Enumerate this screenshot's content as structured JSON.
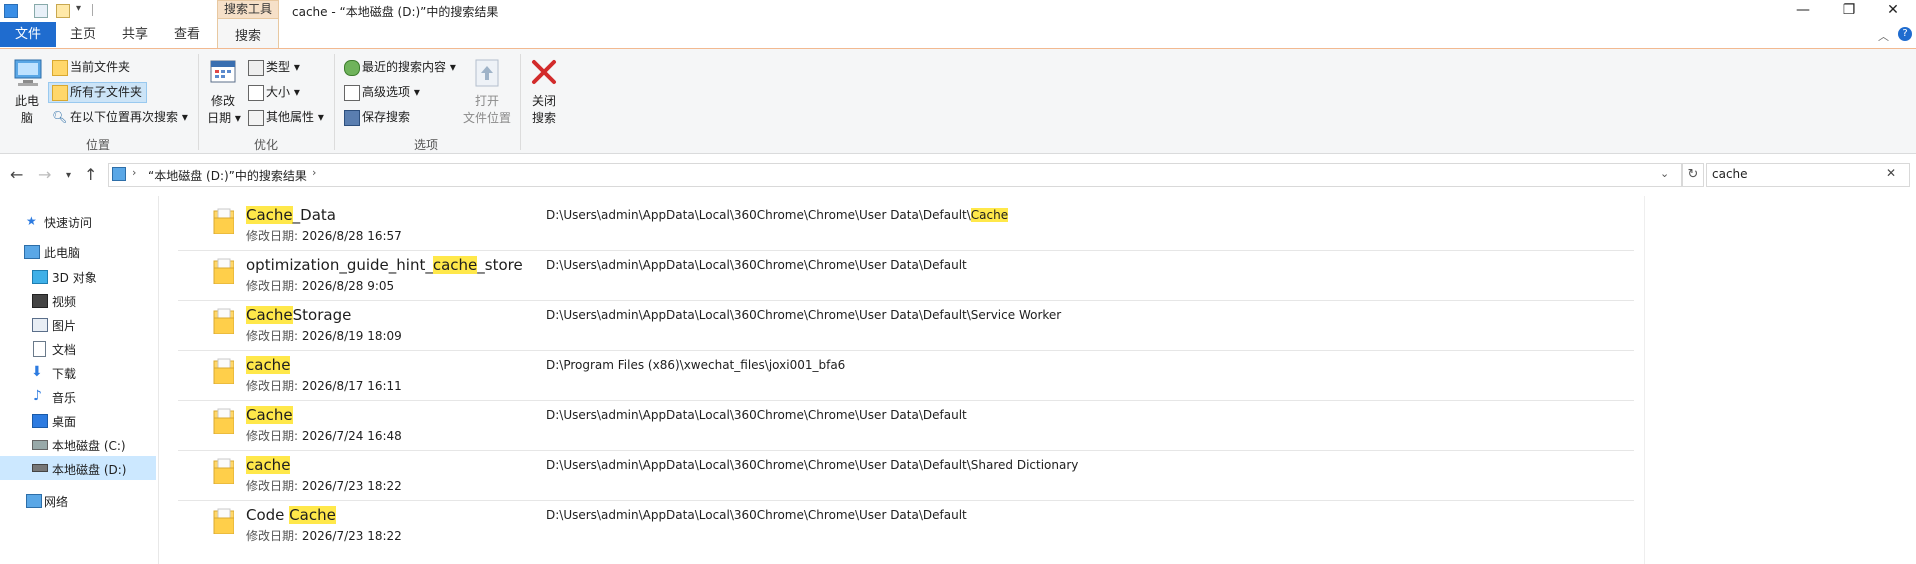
{
  "window": {
    "title": "cache - “本地磁盘 (D:)”中的搜索结果",
    "context_tab_group": "搜索工具",
    "controls": {
      "minimize": "—",
      "maximize": "❐",
      "close": "✕"
    }
  },
  "tabs": {
    "file": "文件",
    "home": "主页",
    "share": "共享",
    "view": "查看",
    "search": "搜索"
  },
  "ribbon": {
    "location": {
      "this_pc_line1": "此电",
      "this_pc_line2": "脑",
      "current_folder": "当前文件夹",
      "all_subfolders": "所有子文件夹",
      "search_again": "在以下位置再次搜索",
      "group_label": "位置"
    },
    "refine": {
      "modified_line1": "修改",
      "modified_line2": "日期",
      "kind": "类型",
      "size": "大小",
      "other_props": "其他属性",
      "group_label": "优化"
    },
    "options": {
      "recent_searches": "最近的搜索内容",
      "advanced": "高级选项",
      "save_search": "保存搜索",
      "open_location_line1": "打开",
      "open_location_line2": "文件位置",
      "group_label": "选项"
    },
    "close": {
      "line1": "关闭",
      "line2": "搜索"
    }
  },
  "address": {
    "breadcrumb": "“本地磁盘 (D:)”中的搜索结果",
    "search_value": "cache"
  },
  "nav": {
    "quick_access": "快速访问",
    "this_pc": "此电脑",
    "objects_3d": "3D 对象",
    "videos": "视频",
    "pictures": "图片",
    "documents": "文档",
    "downloads": "下载",
    "music": "音乐",
    "desktop": "桌面",
    "drive_c": "本地磁盘 (C:)",
    "drive_d": "本地磁盘 (D:)",
    "network": "网络"
  },
  "results": [
    {
      "name_pre": "",
      "name_hl": "Cache",
      "name_post": "_Data",
      "date_label": "修改日期:",
      "date": "2026/8/28 16:57",
      "path_pre": "D:\\Users\\admin\\AppData\\Local\\360Chrome\\Chrome\\User Data\\Default\\",
      "path_hl": "Cache"
    },
    {
      "name_pre": "optimization_guide_hint_",
      "name_hl": "cache",
      "name_post": "_store",
      "date_label": "修改日期:",
      "date": "2026/8/28 9:05",
      "path_pre": "D:\\Users\\admin\\AppData\\Local\\360Chrome\\Chrome\\User Data\\Default",
      "path_hl": ""
    },
    {
      "name_pre": "",
      "name_hl": "Cache",
      "name_post": "Storage",
      "date_label": "修改日期:",
      "date": "2026/8/19 18:09",
      "path_pre": "D:\\Users\\admin\\AppData\\Local\\360Chrome\\Chrome\\User Data\\Default\\Service Worker",
      "path_hl": ""
    },
    {
      "name_pre": "",
      "name_hl": "cache",
      "name_post": "",
      "date_label": "修改日期:",
      "date": "2026/8/17 16:11",
      "path_pre": "D:\\Program Files (x86)\\xwechat_files\\joxi001_bfa6",
      "path_hl": ""
    },
    {
      "name_pre": "",
      "name_hl": "Cache",
      "name_post": "",
      "date_label": "修改日期:",
      "date": "2026/7/24 16:48",
      "path_pre": "D:\\Users\\admin\\AppData\\Local\\360Chrome\\Chrome\\User Data\\Default",
      "path_hl": ""
    },
    {
      "name_pre": "",
      "name_hl": "cache",
      "name_post": "",
      "date_label": "修改日期:",
      "date": "2026/7/23 18:22",
      "path_pre": "D:\\Users\\admin\\AppData\\Local\\360Chrome\\Chrome\\User Data\\Default\\Shared Dictionary",
      "path_hl": ""
    },
    {
      "name_pre": "Code ",
      "name_hl": "Cache",
      "name_post": "",
      "date_label": "修改日期:",
      "date": "2026/7/23 18:22",
      "path_pre": "D:\\Users\\admin\\AppData\\Local\\360Chrome\\Chrome\\User Data\\Default",
      "path_hl": ""
    }
  ]
}
